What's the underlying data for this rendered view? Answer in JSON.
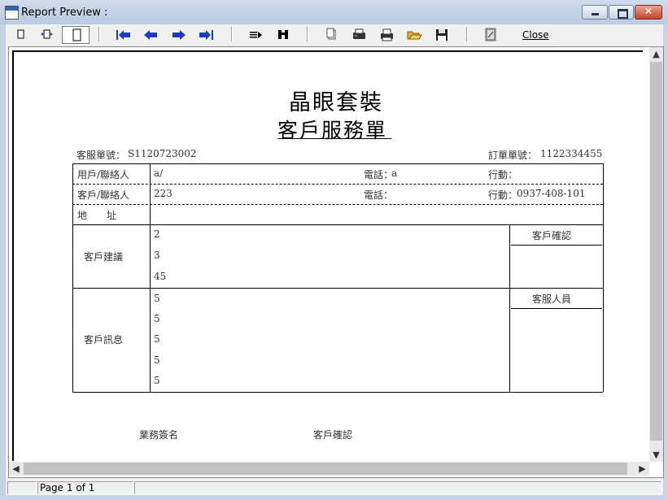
{
  "window": {
    "title": "Report Preview :"
  },
  "toolbar": {
    "close_label": "Close"
  },
  "report": {
    "title1": "晶眼套裝",
    "title2": "客戶服務單",
    "service_no_label": "客服單號：",
    "service_no": "S1120723002",
    "order_no_label": "訂單單號：",
    "order_no": "1122334455",
    "rows": {
      "user_contact_label": "用戶/聯絡人",
      "user_contact_value": "a/",
      "phone1_label": "電話：",
      "phone1_value": "a",
      "mobile1_label": "行動：",
      "mobile1_value": "",
      "cust_contact_label": "客戶/聯絡人",
      "cust_contact_value": "223",
      "phone2_label": "電話：",
      "phone2_value": "",
      "mobile2_label": "行動：",
      "mobile2_value": "0937-408-101",
      "address_label": "地　　址",
      "address_value": ""
    },
    "suggestion_label": "客戶建議",
    "suggestion_lines": [
      "2",
      "3",
      "45"
    ],
    "confirm_label": "客戶確認",
    "message_label": "客戶訊息",
    "message_lines": [
      "5",
      "5",
      "5",
      "5",
      "5"
    ],
    "staff_label": "客服人員",
    "sign_sales": "業務簽名",
    "sign_customer": "客戶確認"
  },
  "status": {
    "page": "Page 1 of 1"
  }
}
